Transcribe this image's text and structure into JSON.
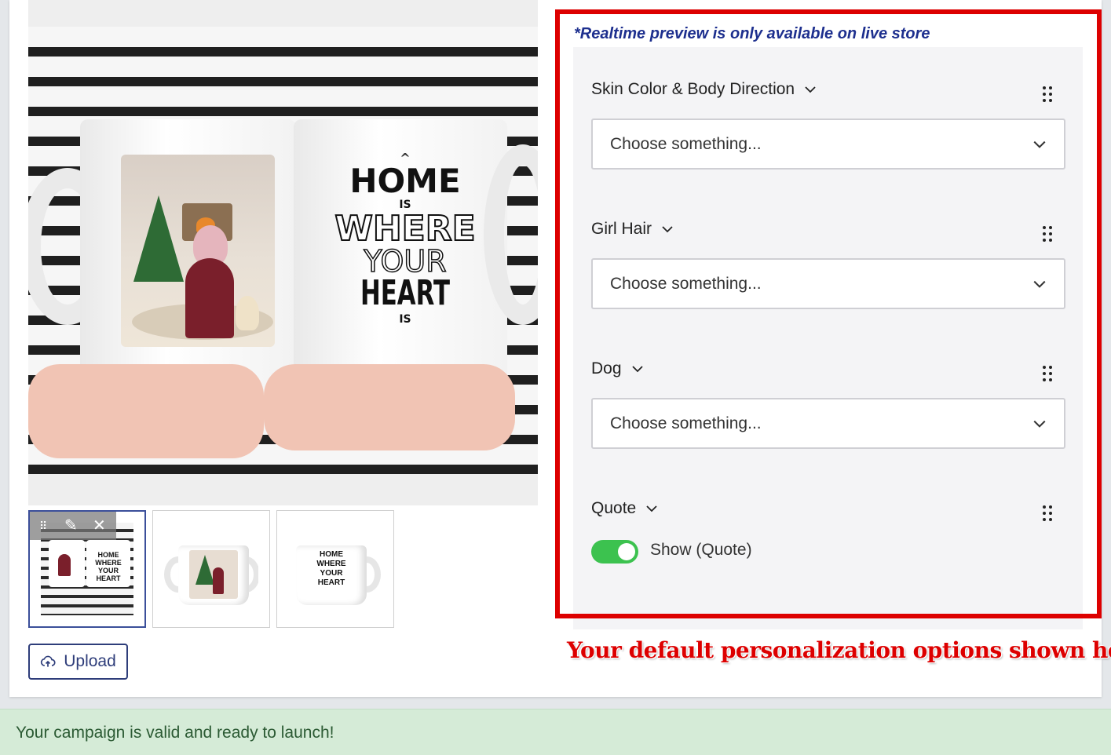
{
  "preview_note": "*Realtime preview is only available on live store",
  "mug_text": {
    "line1": "HOME",
    "line2": "IS",
    "line3": "WHERE",
    "line4": "YOUR",
    "line5": "HEART",
    "line6": "IS"
  },
  "thumbnails": [
    {
      "label": "thumbnail-1",
      "active": true
    },
    {
      "label": "thumbnail-2",
      "active": false
    },
    {
      "label": "thumbnail-3",
      "active": false
    }
  ],
  "thumb_mini_text": {
    "line1": "HOME",
    "line2": "WHERE",
    "line3": "YOUR",
    "line4": "HEART"
  },
  "upload_label": "Upload",
  "options": [
    {
      "title": "Skin Color & Body Direction",
      "placeholder": "Choose something..."
    },
    {
      "title": "Girl Hair",
      "placeholder": "Choose something..."
    },
    {
      "title": "Dog",
      "placeholder": "Choose something..."
    }
  ],
  "quote": {
    "title": "Quote",
    "toggle_label": "Show (Quote)",
    "toggle_on": true
  },
  "callout": "Your default personalization options shown here",
  "status": "Your campaign is valid and ready to launch!",
  "colors": {
    "accent": "#2e3d7a",
    "highlight": "#dd0000",
    "toggle_on": "#3cc24f",
    "success_bg": "#d5ebd7"
  }
}
